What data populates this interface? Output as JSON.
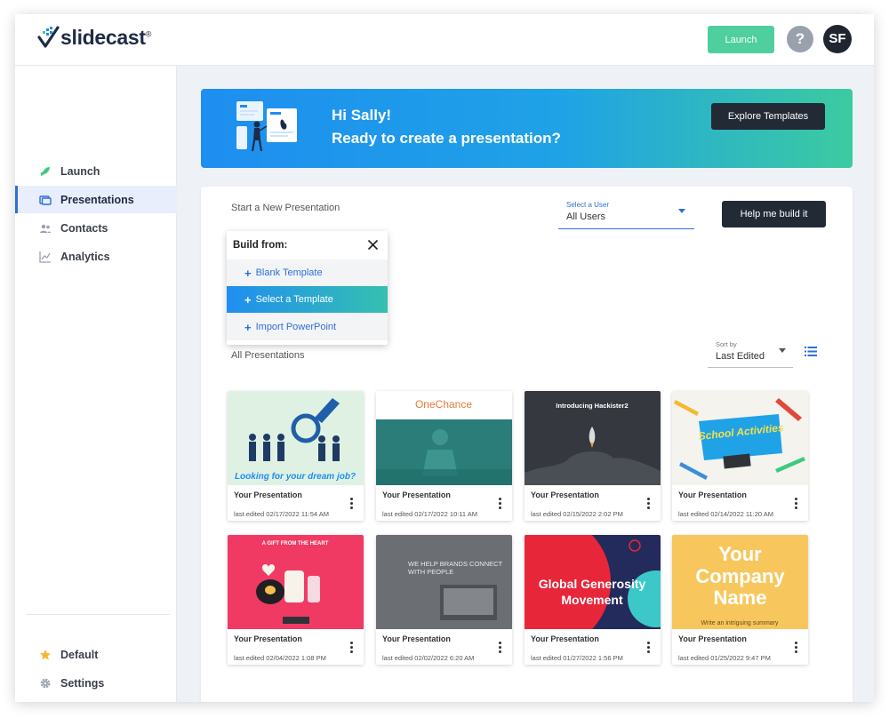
{
  "header": {
    "logo_text": "slidecast",
    "logo_tm": "®",
    "launch_label": "Launch",
    "help_label": "?",
    "avatar_initials": "SF"
  },
  "sidebar": {
    "items": [
      {
        "label": "Launch",
        "icon": "rocket-icon"
      },
      {
        "label": "Presentations",
        "icon": "presentations-icon",
        "active": true
      },
      {
        "label": "Contacts",
        "icon": "contacts-icon"
      },
      {
        "label": "Analytics",
        "icon": "analytics-icon"
      }
    ],
    "bottom_items": [
      {
        "label": "Default",
        "icon": "star-icon"
      },
      {
        "label": "Settings",
        "icon": "gear-icon"
      }
    ]
  },
  "banner": {
    "greeting": "Hi Sally!",
    "subtitle": "Ready to create a presentation?",
    "explore_label": "Explore Templates"
  },
  "main": {
    "start_label": "Start a New Presentation",
    "user_select_caption": "Select a User",
    "user_select_value": "All Users",
    "help_build_label": "Help me build it",
    "all_label": "All Presentations",
    "sort_caption": "Sort by",
    "sort_value": "Last Edited"
  },
  "build_menu": {
    "title": "Build from:",
    "options": [
      {
        "label": "Blank Template"
      },
      {
        "label": "Select a Template",
        "selected": true
      },
      {
        "label": "Import PowerPoint"
      }
    ]
  },
  "presentations": [
    {
      "title": "Your Presentation",
      "date": "last edited 02/17/2022 11:54 AM",
      "thumb_text": "Looking for your dream job?"
    },
    {
      "title": "Your Presentation",
      "date": "last edited 02/17/2022 10:11 AM",
      "thumb_text": "OneChance"
    },
    {
      "title": "Your Presentation",
      "date": "last edited 02/15/2022 2:02 PM",
      "thumb_text": "Introducing Hackister2"
    },
    {
      "title": "Your Presentation",
      "date": "last edited 02/14/2022 11:20 AM",
      "thumb_text": "School Activities"
    },
    {
      "title": "Your Presentation",
      "date": "last edited 02/04/2022 1:08 PM",
      "thumb_text": "A GIFT FROM THE HEART"
    },
    {
      "title": "Your Presentation",
      "date": "last edited 02/02/2022 6:20 AM",
      "thumb_text": "WE HELP BRANDS CONNECT WITH PEOPLE"
    },
    {
      "title": "Your Presentation",
      "date": "last edited 01/27/2022 1:56 PM",
      "thumb_text": "Global Generosity Movement"
    },
    {
      "title": "Your Presentation",
      "date": "last edited 01/25/2022 9:47 PM",
      "thumb_text": "Your Company Name",
      "thumb_sub": "Write an intriguing summary"
    }
  ],
  "colors": {
    "accent": "#2f6fd6",
    "launch_green": "#4fcf9e",
    "dark_button": "#222a36"
  }
}
